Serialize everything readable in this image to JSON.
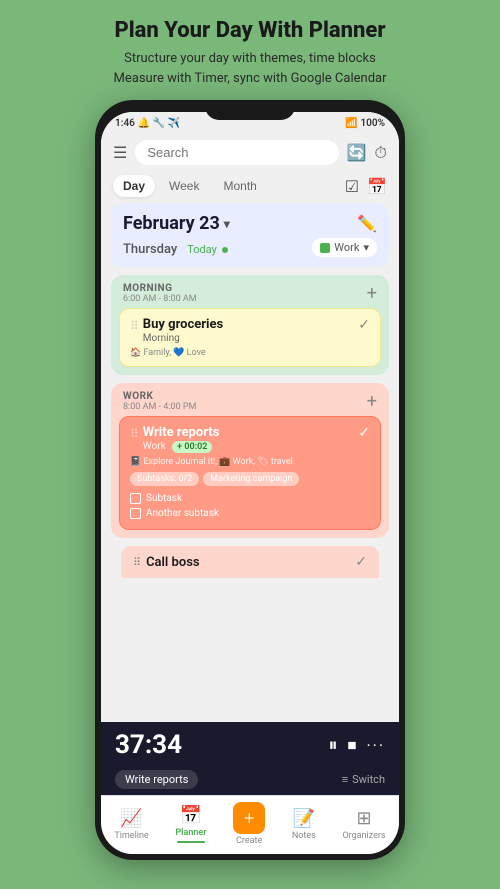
{
  "header": {
    "title": "Plan Your Day With Planner",
    "subtitle": "Structure your day with themes, time blocks\nMeasure with Timer, sync with Google Calendar"
  },
  "statusBar": {
    "time": "1:46",
    "battery": "100%"
  },
  "topBar": {
    "searchPlaceholder": "Search"
  },
  "viewTabs": {
    "tabs": [
      "Day",
      "Week",
      "Month"
    ],
    "activeTab": "Day"
  },
  "dateHeader": {
    "date": "February 23",
    "dayName": "Thursday",
    "todayLabel": "Today",
    "workLabel": "Work"
  },
  "morningSection": {
    "title": "MORNING",
    "time": "6:00 AM - 8:00 AM",
    "task": {
      "name": "Buy groceries",
      "subtitle": "Morning",
      "tags": "🏠 Family, 💙 Love"
    }
  },
  "workSection": {
    "title": "WORK",
    "time": "8:00 AM - 4:00 PM",
    "task": {
      "name": "Write reports",
      "subtitle": "Work",
      "timeBadge": "+ 00:02",
      "tags": "📓 Explore Journal it!, 💼 Work, 🏷 travel",
      "subtasksLabel": "Subtasks: 0/2",
      "marketingLabel": "Marketing campaign",
      "subtask1": "Subtask",
      "subtask2": "Another subtask"
    }
  },
  "callBoss": {
    "name": "Call boss"
  },
  "timer": {
    "display": "37:34",
    "taskLabel": "Write reports",
    "switchLabel": "Switch"
  },
  "bottomNav": {
    "items": [
      {
        "icon": "📈",
        "label": "Timeline",
        "active": false
      },
      {
        "icon": "📅",
        "label": "Planner",
        "active": true
      },
      {
        "icon": "+",
        "label": "Create",
        "active": false
      },
      {
        "icon": "📝",
        "label": "Notes",
        "active": false
      },
      {
        "icon": "⊞",
        "label": "Organizers",
        "active": false
      }
    ]
  }
}
